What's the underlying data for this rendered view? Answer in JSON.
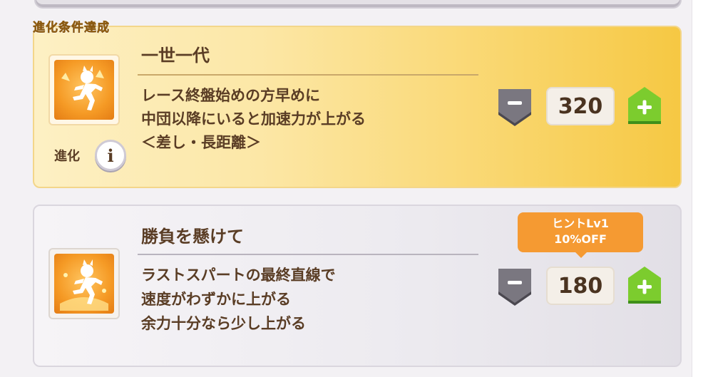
{
  "header": {
    "evolution_tag": "進化条件達成"
  },
  "skills": [
    {
      "name": "一世一代",
      "description": [
        "レース終盤始めの方早めに",
        "中団以降にいると加速力が上がる",
        "＜差し・長距離＞"
      ],
      "cost": "320",
      "evolution_label": "進化",
      "info_glyph": "i",
      "icon": "running-figure-icon",
      "accent": "#f6c843"
    },
    {
      "name": "勝負を懸けて",
      "description": [
        "ラストスパートの最終直線で",
        "速度がわずかに上がる",
        "余力十分なら少し上がる"
      ],
      "cost": "180",
      "hint": {
        "line1": "ヒントLv1",
        "line2": "10%OFF"
      },
      "icon": "running-figure-icon",
      "accent": "#e2dfe6"
    }
  ],
  "controls": {
    "minus_symbol": "－",
    "plus_symbol": "＋",
    "minus_color": "#6f6c73",
    "plus_color": "#6fc126"
  }
}
